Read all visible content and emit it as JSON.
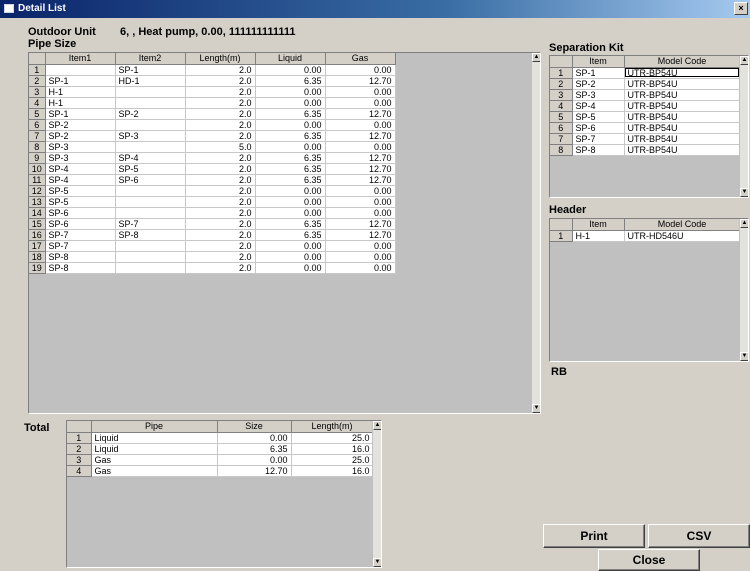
{
  "window": {
    "title": "Detail List",
    "close_glyph": "×"
  },
  "outdoor_unit": {
    "label": "Outdoor Unit",
    "value": "6, , Heat pump, 0.00, 111111111111"
  },
  "pipe_size": {
    "label": "Pipe Size",
    "columns": [
      "",
      "Item1",
      "Item2",
      "Length(m)",
      "Liquid",
      "Gas"
    ],
    "rows": [
      [
        "1",
        "",
        "SP-1",
        "2.0",
        "0.00",
        "0.00"
      ],
      [
        "2",
        "SP-1",
        "HD-1",
        "2.0",
        "6.35",
        "12.70"
      ],
      [
        "3",
        "H-1",
        "",
        "2.0",
        "0.00",
        "0.00"
      ],
      [
        "4",
        "H-1",
        "",
        "2.0",
        "0.00",
        "0.00"
      ],
      [
        "5",
        "SP-1",
        "SP-2",
        "2.0",
        "6.35",
        "12.70"
      ],
      [
        "6",
        "SP-2",
        "",
        "2.0",
        "0.00",
        "0.00"
      ],
      [
        "7",
        "SP-2",
        "SP-3",
        "2.0",
        "6.35",
        "12.70"
      ],
      [
        "8",
        "SP-3",
        "",
        "5.0",
        "0.00",
        "0.00"
      ],
      [
        "9",
        "SP-3",
        "SP-4",
        "2.0",
        "6.35",
        "12.70"
      ],
      [
        "10",
        "SP-4",
        "SP-5",
        "2.0",
        "6.35",
        "12.70"
      ],
      [
        "11",
        "SP-4",
        "SP-6",
        "2.0",
        "6.35",
        "12.70"
      ],
      [
        "12",
        "SP-5",
        "",
        "2.0",
        "0.00",
        "0.00"
      ],
      [
        "13",
        "SP-5",
        "",
        "2.0",
        "0.00",
        "0.00"
      ],
      [
        "14",
        "SP-6",
        "",
        "2.0",
        "0.00",
        "0.00"
      ],
      [
        "15",
        "SP-6",
        "SP-7",
        "2.0",
        "6.35",
        "12.70"
      ],
      [
        "16",
        "SP-7",
        "SP-8",
        "2.0",
        "6.35",
        "12.70"
      ],
      [
        "17",
        "SP-7",
        "",
        "2.0",
        "0.00",
        "0.00"
      ],
      [
        "18",
        "SP-8",
        "",
        "2.0",
        "0.00",
        "0.00"
      ],
      [
        "19",
        "SP-8",
        "",
        "2.0",
        "0.00",
        "0.00"
      ]
    ]
  },
  "separation_kit": {
    "label": "Separation Kit",
    "columns": [
      "",
      "Item",
      "Model Code"
    ],
    "rows": [
      [
        "1",
        "SP-1",
        "UTR-BP54U"
      ],
      [
        "2",
        "SP-2",
        "UTR-BP54U"
      ],
      [
        "3",
        "SP-3",
        "UTR-BP54U"
      ],
      [
        "4",
        "SP-4",
        "UTR-BP54U"
      ],
      [
        "5",
        "SP-5",
        "UTR-BP54U"
      ],
      [
        "6",
        "SP-6",
        "UTR-BP54U"
      ],
      [
        "7",
        "SP-7",
        "UTR-BP54U"
      ],
      [
        "8",
        "SP-8",
        "UTR-BP54U"
      ]
    ]
  },
  "header_section": {
    "label": "Header",
    "columns": [
      "",
      "Item",
      "Model Code"
    ],
    "rows": [
      [
        "1",
        "H-1",
        "UTR-HD546U"
      ]
    ]
  },
  "rb_label": "RB",
  "total": {
    "label": "Total",
    "columns": [
      "",
      "Pipe",
      "Size",
      "Length(m)"
    ],
    "rows": [
      [
        "1",
        "Liquid",
        "0.00",
        "25.0"
      ],
      [
        "2",
        "Liquid",
        "6.35",
        "16.0"
      ],
      [
        "3",
        "Gas",
        "0.00",
        "25.0"
      ],
      [
        "4",
        "Gas",
        "12.70",
        "16.0"
      ]
    ]
  },
  "buttons": {
    "print": "Print",
    "csv": "CSV",
    "close": "Close"
  },
  "scroll": {
    "up": "▲",
    "down": "▼"
  }
}
